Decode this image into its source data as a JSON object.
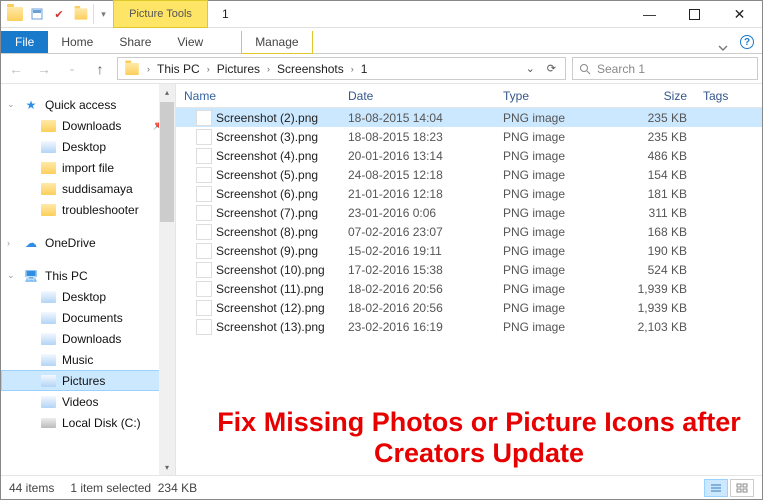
{
  "title": "1",
  "context_tab": "Picture Tools",
  "ribbon": {
    "file": "File",
    "home": "Home",
    "share": "Share",
    "view": "View",
    "manage": "Manage"
  },
  "breadcrumb": [
    "This PC",
    "Pictures",
    "Screenshots",
    "1"
  ],
  "search_placeholder": "Search 1",
  "sidebar": {
    "quick": "Quick access",
    "downloads": "Downloads",
    "desktop": "Desktop",
    "import": "import file",
    "suddisamaya": "suddisamaya",
    "troubleshooter": "troubleshooter",
    "onedrive": "OneDrive",
    "thispc": "This PC",
    "pc_desktop": "Desktop",
    "pc_documents": "Documents",
    "pc_downloads": "Downloads",
    "pc_music": "Music",
    "pc_pictures": "Pictures",
    "pc_videos": "Videos",
    "pc_localdisk": "Local Disk (C:)"
  },
  "columns": {
    "name": "Name",
    "date": "Date",
    "type": "Type",
    "size": "Size",
    "tags": "Tags"
  },
  "files": [
    {
      "name": "Screenshot (2).png",
      "date": "18-08-2015 14:04",
      "type": "PNG image",
      "size": "235 KB"
    },
    {
      "name": "Screenshot (3).png",
      "date": "18-08-2015 18:23",
      "type": "PNG image",
      "size": "235 KB"
    },
    {
      "name": "Screenshot (4).png",
      "date": "20-01-2016 13:14",
      "type": "PNG image",
      "size": "486 KB"
    },
    {
      "name": "Screenshot (5).png",
      "date": "24-08-2015 12:18",
      "type": "PNG image",
      "size": "154 KB"
    },
    {
      "name": "Screenshot (6).png",
      "date": "21-01-2016 12:18",
      "type": "PNG image",
      "size": "181 KB"
    },
    {
      "name": "Screenshot (7).png",
      "date": "23-01-2016 0:06",
      "type": "PNG image",
      "size": "311 KB"
    },
    {
      "name": "Screenshot (8).png",
      "date": "07-02-2016 23:07",
      "type": "PNG image",
      "size": "168 KB"
    },
    {
      "name": "Screenshot (9).png",
      "date": "15-02-2016 19:11",
      "type": "PNG image",
      "size": "190 KB"
    },
    {
      "name": "Screenshot (10).png",
      "date": "17-02-2016 15:38",
      "type": "PNG image",
      "size": "524 KB"
    },
    {
      "name": "Screenshot (11).png",
      "date": "18-02-2016 20:56",
      "type": "PNG image",
      "size": "1,939 KB"
    },
    {
      "name": "Screenshot (12).png",
      "date": "18-02-2016 20:56",
      "type": "PNG image",
      "size": "1,939 KB"
    },
    {
      "name": "Screenshot (13).png",
      "date": "23-02-2016 16:19",
      "type": "PNG image",
      "size": "2,103 KB"
    }
  ],
  "selected_index": 0,
  "overlay_text": "Fix Missing Photos or Picture Icons after Creators Update",
  "status": {
    "count": "44 items",
    "sel": "1 item selected",
    "size": "234 KB"
  }
}
